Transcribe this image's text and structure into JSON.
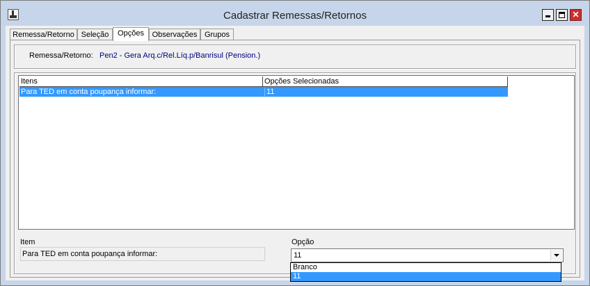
{
  "window": {
    "title": "Cadastrar Remessas/Retornos"
  },
  "controls": {
    "minimize_icon": "minimize-icon",
    "maximize_icon": "maximize-icon",
    "close_glyph": "✕"
  },
  "tabs": [
    "Remessa/Retorno",
    "Seleção",
    "Opções",
    "Observações",
    "Grupos"
  ],
  "active_tab": "Opções",
  "remessa": {
    "label": "Remessa/Retorno:",
    "value": "Pen2 - Gera Arq.c/Rel.Líq.p/Banrisul (Pension.)"
  },
  "grid": {
    "columns": [
      "Itens",
      "Opções Selecionadas"
    ],
    "rows": [
      {
        "item": "Para TED em conta poupança informar:",
        "option": "11"
      }
    ]
  },
  "form": {
    "item_label": "Item",
    "item_value": "Para TED em conta poupança informar:",
    "option_label": "Opção",
    "option_value": "11",
    "options": [
      "Branco",
      "11"
    ]
  },
  "colors": {
    "selection": "#3399ff",
    "title_bar": "#c6d5ea",
    "close_button": "#c9302c"
  }
}
